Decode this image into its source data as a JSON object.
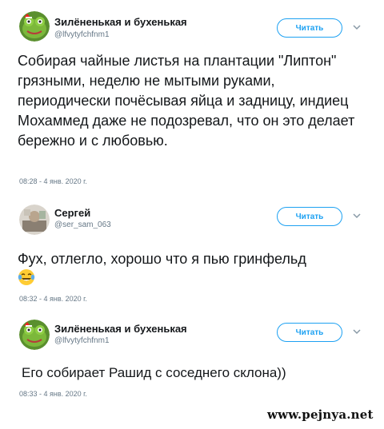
{
  "tweets": [
    {
      "user": {
        "name": "Зилёненькая и бухенькая",
        "handle": "@lfvytyfchfnm1",
        "avatar": "frog-avatar"
      },
      "follow_label": "Читать",
      "text": "Собирая чайные листья на плантации \"Липтон\" грязными, неделю не мытыми руками, периодически почёсывая яйца и задницу, индиец Мохаммед даже не подозревал, что он это делает бережно и с любовью.",
      "timestamp": "08:28 - 4 янв. 2020 г."
    },
    {
      "user": {
        "name": "Сергей",
        "handle": "@ser_sam_063",
        "avatar": "photo-avatar"
      },
      "follow_label": "Читать",
      "text": "Фух, отлегло, хорошо что я пью гринфельд",
      "emoji": "tears-of-joy-emoji",
      "timestamp": "08:32 - 4 янв. 2020 г."
    },
    {
      "user": {
        "name": "Зилёненькая и бухенькая",
        "handle": "@lfvytyfchfnm1",
        "avatar": "frog-avatar"
      },
      "follow_label": "Читать",
      "text": "Его собирает Рашид с соседнего склона))",
      "timestamp": "08:33 - 4 янв. 2020 г."
    }
  ],
  "watermark": "www.pejnya.net",
  "colors": {
    "accent": "#1da1f2",
    "muted": "#657786",
    "text": "#14171a"
  }
}
